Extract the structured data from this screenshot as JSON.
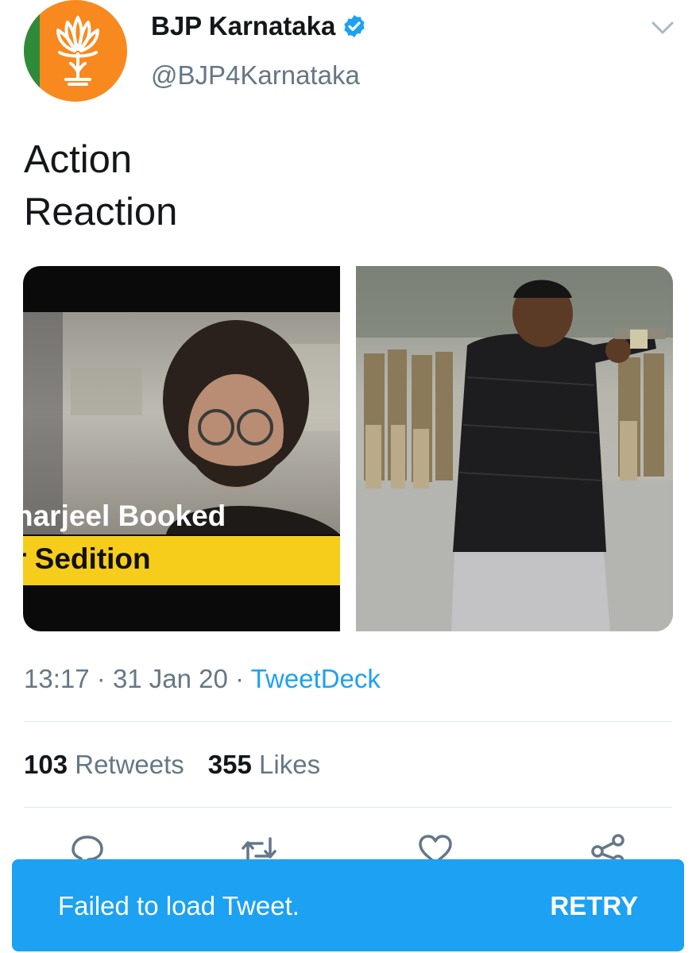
{
  "account": {
    "name": "BJP Karnataka",
    "handle": "@BJP4Karnataka",
    "verified": true,
    "avatar_icon": "lotus-logo"
  },
  "tweet": {
    "lines": [
      "Action",
      "Reaction"
    ],
    "media": {
      "left_caption_line1": "harjeel Booked",
      "left_caption_line2": "r Sedition"
    },
    "time": "13:17",
    "separator": "·",
    "date": "31 Jan 20",
    "source": "TweetDeck"
  },
  "stats": {
    "retweets_count": "103",
    "retweets_label": "Retweets",
    "likes_count": "355",
    "likes_label": "Likes"
  },
  "actions": [
    "reply-icon",
    "retweet-icon",
    "like-icon",
    "share-icon"
  ],
  "toast": {
    "message": "Failed to load Tweet.",
    "retry_label": "RETRY"
  },
  "colors": {
    "accent": "#1da1f2",
    "muted": "#657786",
    "caption_bar": "#f6cd1b",
    "avatar_orange": "#f7891f"
  }
}
